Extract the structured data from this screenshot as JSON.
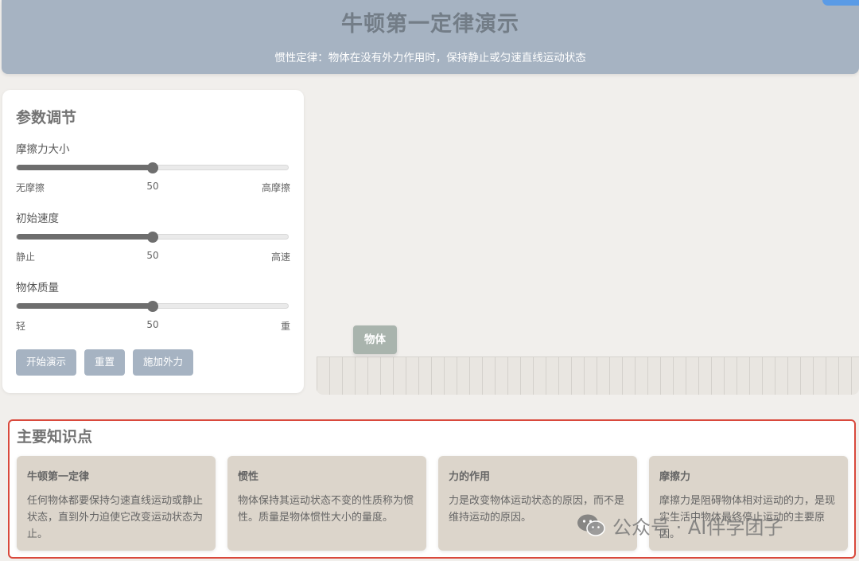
{
  "header": {
    "title": "牛顿第一定律演示",
    "subtitle": "惯性定律：物体在没有外力作用时，保持静止或匀速直线运动状态"
  },
  "params": {
    "title": "参数调节",
    "sliders": [
      {
        "label": "摩擦力大小",
        "min_label": "无摩擦",
        "value_label": "50",
        "max_label": "高摩擦",
        "value": 50,
        "min": 0,
        "max": 100
      },
      {
        "label": "初始速度",
        "min_label": "静止",
        "value_label": "50",
        "max_label": "高速",
        "value": 50,
        "min": 0,
        "max": 100
      },
      {
        "label": "物体质量",
        "min_label": "轻",
        "value_label": "50",
        "max_label": "重",
        "value": 50,
        "min": 0,
        "max": 100
      }
    ],
    "buttons": {
      "start": "开始演示",
      "reset": "重置",
      "apply_force": "施加外力"
    }
  },
  "stage": {
    "object_label": "物体"
  },
  "knowledge": {
    "title": "主要知识点",
    "cards": [
      {
        "title": "牛顿第一定律",
        "body": "任何物体都要保持匀速直线运动或静止状态，直到外力迫使它改变运动状态为止。"
      },
      {
        "title": "惯性",
        "body": "物体保持其运动状态不变的性质称为惯性。质量是物体惯性大小的量度。"
      },
      {
        "title": "力的作用",
        "body": "力是改变物体运动状态的原因，而不是维持运动的原因。"
      },
      {
        "title": "摩擦力",
        "body": "摩擦力是阻碍物体相对运动的力，是现实生活中物体最终停止运动的主要原因。"
      }
    ]
  },
  "watermark": {
    "text": "公众号 · AI伴学团子",
    "icon": "wechat-icon"
  },
  "colors": {
    "header_bg": "#a6b3c2",
    "button_bg": "#a6b3c2",
    "object_bg": "#a9b4ad",
    "card_bg": "#dcd5cb",
    "highlight_border": "#d9493c"
  }
}
